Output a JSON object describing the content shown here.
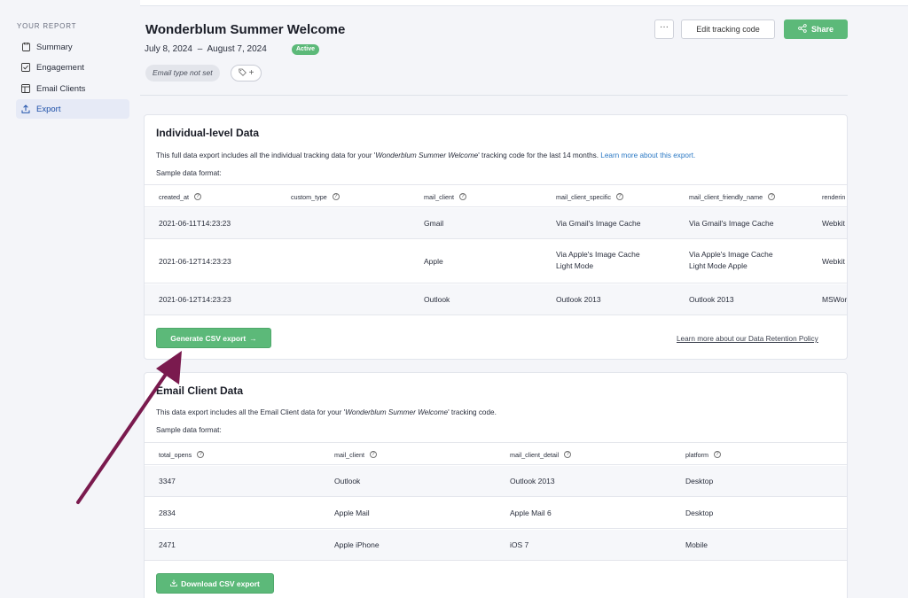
{
  "sidebar": {
    "heading": "YOUR REPORT",
    "items": [
      {
        "label": "Summary",
        "icon": "clipboard-icon"
      },
      {
        "label": "Engagement",
        "icon": "checkbox-icon"
      },
      {
        "label": "Email Clients",
        "icon": "window-icon"
      },
      {
        "label": "Export",
        "icon": "upload-icon"
      }
    ]
  },
  "header": {
    "title": "Wonderblum Summer Welcome",
    "date_start": "July 8, 2024",
    "date_sep": "–",
    "date_end": "August 7, 2024",
    "status": "Active",
    "email_type": "Email type not set",
    "more_label": "···",
    "edit_label": "Edit tracking code",
    "share_label": "Share"
  },
  "individual": {
    "title": "Individual-level Data",
    "desc_pre": "This full data export includes all the individual tracking data for your '",
    "desc_name": "Wonderblum Summer Welcome",
    "desc_post": "' tracking code for the last 14 months. ",
    "desc_link": "Learn more about this export.",
    "sample": "Sample data format:",
    "columns": [
      "created_at",
      "custom_type",
      "mail_client",
      "mail_client_specific",
      "mail_client_friendly_name",
      "renderin"
    ],
    "rows": [
      [
        "2021-06-11T14:23:23",
        "",
        "Gmail",
        "Via Gmail's Image Cache",
        "Via Gmail's Image Cache",
        "Webkit"
      ],
      [
        "2021-06-12T14:23:23",
        "",
        "Apple",
        "Via Apple's Image Cache\nLight Mode",
        "Via Apple's Image Cache\nLight Mode Apple",
        "Webkit"
      ],
      [
        "2021-06-12T14:23:23",
        "",
        "Outlook",
        "Outlook 2013",
        "Outlook 2013",
        "MSWor"
      ]
    ],
    "button_label": "Generate CSV export",
    "retention_link": "Learn more about our Data Retention Policy"
  },
  "client": {
    "title": "Email Client Data",
    "desc_pre": "This data export includes all the Email Client data for your '",
    "desc_name": "Wonderblum Summer Welcome",
    "desc_post": "' tracking code.",
    "sample": "Sample data format:",
    "columns": [
      "total_opens",
      "mail_client",
      "mail_client_detail",
      "platform"
    ],
    "rows": [
      [
        "3347",
        "Outlook",
        "Outlook 2013",
        "Desktop"
      ],
      [
        "2834",
        "Apple Mail",
        "Apple Mail 6",
        "Desktop"
      ],
      [
        "2471",
        "Apple iPhone",
        "iOS 7",
        "Mobile"
      ]
    ],
    "button_label": "Download CSV export"
  },
  "colors": {
    "accent_green": "#5cb979",
    "active_nav": "#1c4fa8",
    "link": "#2a78c4",
    "annotation_arrow": "#7a1a4e"
  }
}
